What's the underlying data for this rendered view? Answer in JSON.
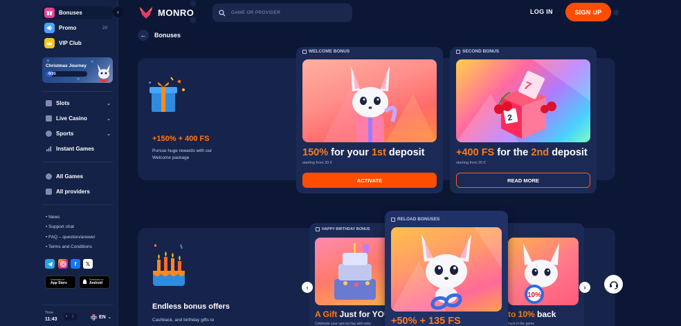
{
  "sidebar": {
    "top_items": [
      {
        "label": "Bonuses",
        "icon": "gift-icon",
        "color": "#e8409a"
      },
      {
        "label": "Promo",
        "icon": "promo-icon",
        "color": "#4aa3ff",
        "count": "20"
      },
      {
        "label": "VIP Club",
        "icon": "crown-icon",
        "color": "#f5c518"
      }
    ],
    "promo": {
      "title": "Christmas Journey",
      "progress": "6/31",
      "progress_value": 0.19
    },
    "nav": [
      {
        "label": "Slots",
        "has_chevron": true
      },
      {
        "label": "Live Casino",
        "has_chevron": true
      },
      {
        "label": "Sports",
        "has_chevron": true
      },
      {
        "label": "Instant Games",
        "has_chevron": false
      }
    ],
    "nav2": [
      {
        "label": "All Games"
      },
      {
        "label": "All providers"
      }
    ],
    "links": [
      "News",
      "Support chat",
      "FAQ – question/answer",
      "Terms and Conditions"
    ],
    "stores": [
      {
        "small": "Download on",
        "big": "App Store"
      },
      {
        "small": "Download on",
        "big": "Android"
      }
    ],
    "time_label": "Time",
    "time_value": "11:43",
    "language": "EN"
  },
  "header": {
    "brand": "MONRO",
    "search_placeholder": "GAME OR PROVIDER",
    "login": "LOG IN",
    "signup": "SIGN UP",
    "accent": "#ff4d00"
  },
  "page": {
    "back_title": "Bonuses"
  },
  "welcome_section": {
    "headline": "+150% + 400 FS",
    "description_line1": "Pursue huge rewards with our",
    "description_line2": "Welcome package",
    "cards": [
      {
        "label": "WELCOME BONUS",
        "title_pre": "150%",
        "title_mid": " for your ",
        "title_hl": "1st",
        "title_post": " deposit",
        "sub": "starting from 20 €",
        "button": "ACTIVATE"
      },
      {
        "label": "SECOND BONUS",
        "title_pre": "+400 FS",
        "title_mid": " for the ",
        "title_hl": "2nd",
        "title_post": " deposit",
        "sub": "starting from 20 €",
        "button": "READ MORE"
      }
    ]
  },
  "endless_section": {
    "headline": "Endless bonus offers",
    "description_line1": "Cashback, and birthday gifts to",
    "cards": [
      {
        "label": "HAPPY BIRTHDAY BONUS",
        "title_pre": "A Gift",
        "title_mid": " Just for YOU",
        "sub": "Celebrate your special day with wins"
      },
      {
        "label": "RELOAD BONUSES",
        "title": "+50% + 135 FS"
      },
      {
        "title_pre": "to 10%",
        "title_mid": " back",
        "sub": "back in the game"
      }
    ],
    "badge_text": "10%"
  }
}
